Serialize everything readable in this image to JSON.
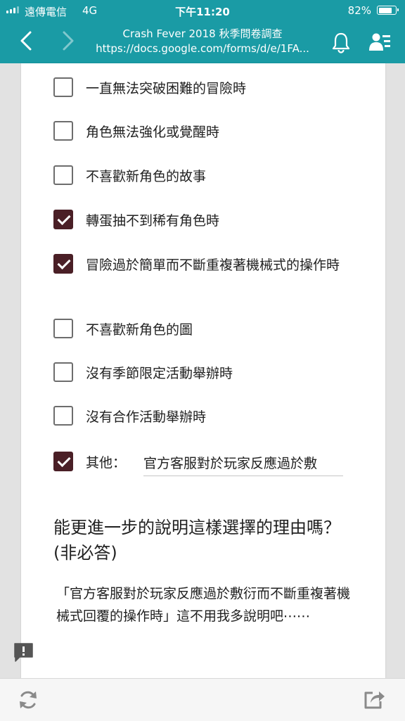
{
  "status_bar": {
    "carrier": "遠傳電信",
    "network": "4G",
    "time": "下午11:20",
    "battery_percent": "82%",
    "battery_level": 0.82
  },
  "nav": {
    "back_icon": "chevron-left-icon",
    "forward_icon": "chevron-right-icon",
    "page_title": "Crash Fever 2018 秋季問卷調查",
    "page_url": "https://docs.google.com/forms/d/e/1FA...",
    "bell_icon": "bell-icon",
    "profile_icon": "profile-list-icon"
  },
  "options": [
    {
      "label": "一直無法突破困難的冒險時",
      "checked": false
    },
    {
      "label": "角色無法強化或覺醒時",
      "checked": false
    },
    {
      "label": "不喜歡新角色的故事",
      "checked": false
    },
    {
      "label": "轉蛋抽不到稀有角色時",
      "checked": true
    },
    {
      "label": "冒險過於簡單而不斷重複著機械式的操作時",
      "checked": true
    },
    {
      "label": "不喜歡新角色的圖",
      "checked": false
    },
    {
      "label": "沒有季節限定活動舉辦時",
      "checked": false
    },
    {
      "label": "沒有合作活動舉辦時",
      "checked": false
    }
  ],
  "other_option": {
    "label": "其他：",
    "checked": true,
    "value": "官方客服對於玩家反應過於敷"
  },
  "question": {
    "title": "能更進一步的說明這樣選擇的理由嗎？(非必答)",
    "answer": "「官方客服對於玩家反應過於敷衍而不斷重複著機械式回覆的操作時」這不用我多說明吧⋯⋯"
  },
  "colors": {
    "toolbar": "#1a9ba5",
    "checkbox_checked": "#4a1f26",
    "page_background": "#e2e2e2"
  }
}
